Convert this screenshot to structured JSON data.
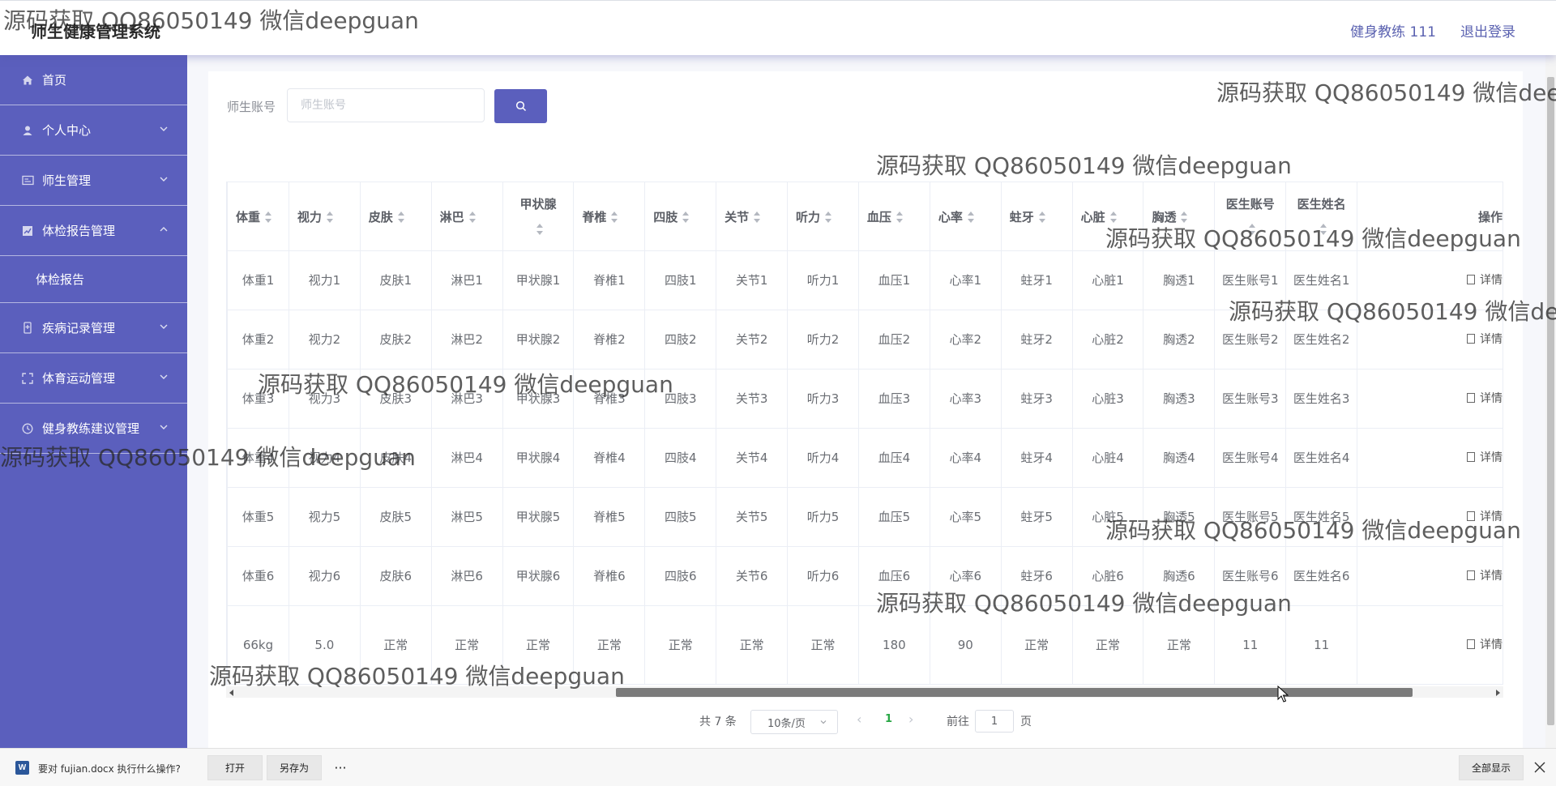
{
  "app": {
    "title": "师生健康管理系统"
  },
  "header": {
    "user": "健身教练 111",
    "logout": "退出登录"
  },
  "sidebar": {
    "items": [
      {
        "label": "首页",
        "icon": "home-icon"
      },
      {
        "label": "个人中心",
        "icon": "user-icon"
      },
      {
        "label": "师生管理",
        "icon": "id-card-icon"
      },
      {
        "label": "体检报告管理",
        "icon": "chart-icon",
        "expanded": true
      },
      {
        "label": "体检报告",
        "submenu": true
      },
      {
        "label": "疾病记录管理",
        "icon": "medical-icon"
      },
      {
        "label": "体育运动管理",
        "icon": "fullscreen-icon"
      },
      {
        "label": "健身教练建议管理",
        "icon": "clock-icon"
      }
    ]
  },
  "search": {
    "label": "师生账号",
    "placeholder": "师生账号",
    "value": ""
  },
  "table": {
    "columns": [
      "体重",
      "视力",
      "皮肤",
      "淋巴",
      "甲状腺",
      "脊椎",
      "四肢",
      "关节",
      "听力",
      "血压",
      "心率",
      "蛀牙",
      "心脏",
      "胸透",
      "医生账号",
      "医生姓名",
      "操作"
    ],
    "rows": [
      [
        "体重1",
        "视力1",
        "皮肤1",
        "淋巴1",
        "甲状腺1",
        "脊椎1",
        "四肢1",
        "关节1",
        "听力1",
        "血压1",
        "心率1",
        "蛀牙1",
        "心脏1",
        "胸透1",
        "医生账号1",
        "医生姓名1"
      ],
      [
        "体重2",
        "视力2",
        "皮肤2",
        "淋巴2",
        "甲状腺2",
        "脊椎2",
        "四肢2",
        "关节2",
        "听力2",
        "血压2",
        "心率2",
        "蛀牙2",
        "心脏2",
        "胸透2",
        "医生账号2",
        "医生姓名2"
      ],
      [
        "体重3",
        "视力3",
        "皮肤3",
        "淋巴3",
        "甲状腺3",
        "脊椎3",
        "四肢3",
        "关节3",
        "听力3",
        "血压3",
        "心率3",
        "蛀牙3",
        "心脏3",
        "胸透3",
        "医生账号3",
        "医生姓名3"
      ],
      [
        "体重4",
        "视力4",
        "皮肤4",
        "淋巴4",
        "甲状腺4",
        "脊椎4",
        "四肢4",
        "关节4",
        "听力4",
        "血压4",
        "心率4",
        "蛀牙4",
        "心脏4",
        "胸透4",
        "医生账号4",
        "医生姓名4"
      ],
      [
        "体重5",
        "视力5",
        "皮肤5",
        "淋巴5",
        "甲状腺5",
        "脊椎5",
        "四肢5",
        "关节5",
        "听力5",
        "血压5",
        "心率5",
        "蛀牙5",
        "心脏5",
        "胸透5",
        "医生账号5",
        "医生姓名5"
      ],
      [
        "体重6",
        "视力6",
        "皮肤6",
        "淋巴6",
        "甲状腺6",
        "脊椎6",
        "四肢6",
        "关节6",
        "听力6",
        "血压6",
        "心率6",
        "蛀牙6",
        "心脏6",
        "胸透6",
        "医生账号6",
        "医生姓名6"
      ],
      [
        "66kg",
        "5.0",
        "正常",
        "正常",
        "正常",
        "正常",
        "正常",
        "正常",
        "正常",
        "180",
        "90",
        "正常",
        "正常",
        "正常",
        "11",
        "11"
      ]
    ],
    "action_label": "详情"
  },
  "pagination": {
    "total": "共 7 条",
    "page_size": "10条/页",
    "current": "1",
    "goto_prefix": "前往",
    "goto_value": "1",
    "goto_suffix": "页"
  },
  "download": {
    "question": "要对 fujian.docx 执行什么操作?",
    "open": "打开",
    "save_as": "另存为",
    "more": "···",
    "show_all": "全部显示",
    "file_icon_letter": "W"
  },
  "watermarks": [
    "源码获取 QQ86050149 微信deepguan"
  ],
  "colors": {
    "sidebar": "#5b5fbd",
    "accent": "#5b5fbd",
    "header_text": "#5a61b0",
    "pagination_active": "#28a745"
  }
}
